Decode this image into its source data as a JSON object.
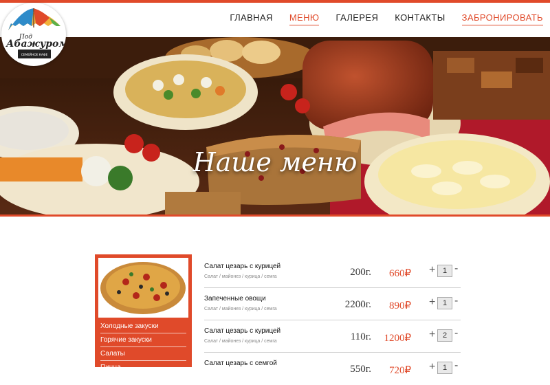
{
  "header": {
    "nav": [
      {
        "label": "ГЛАВНАЯ"
      },
      {
        "label": "МЕНЮ"
      },
      {
        "label": "ГАЛЕРЕЯ"
      },
      {
        "label": "КОНТАКТЫ"
      },
      {
        "label": "ЗАБРОНИРОВАТЬ"
      }
    ],
    "logo": {
      "line1": "Под",
      "line2": "Абажуром",
      "badge": "СЕМЕЙНОЕ КАФЕ"
    }
  },
  "hero": {
    "title": "Наше меню"
  },
  "sidebar": {
    "categories": [
      "Холодные закуски",
      "Горячие закуски",
      "Салаты",
      "Пицца"
    ]
  },
  "menu": {
    "currency": "₽",
    "items": [
      {
        "title": "Салат цезарь с курицей",
        "ingredients": "Салат / майонез / курица / семга",
        "weight": "200г.",
        "price": "660₽",
        "qty": "1"
      },
      {
        "title": "Запеченные овощи",
        "ingredients": "Салат / майонез / курица / семга",
        "weight": "2200г.",
        "price": "890₽",
        "qty": "1"
      },
      {
        "title": "Салат цезарь с курицей",
        "ingredients": "Салат / майонез / курица / семга",
        "weight": "110г.",
        "price": "1200₽",
        "qty": "2"
      },
      {
        "title": "Салат цезарь с семгой",
        "ingredients": "",
        "weight": "550г.",
        "price": "720₽",
        "qty": "1"
      }
    ],
    "plus": "+",
    "minus": "-"
  },
  "colors": {
    "accent": "#e04a2a"
  }
}
